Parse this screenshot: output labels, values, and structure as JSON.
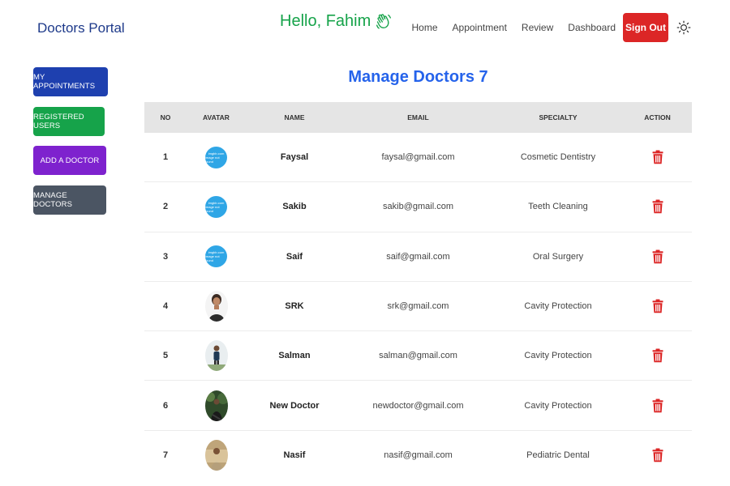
{
  "header": {
    "brand": "Doctors Portal",
    "greeting": "Hello, Fahim",
    "nav": [
      "Home",
      "Appointment",
      "Review",
      "Dashboard"
    ],
    "sign_out": "Sign Out"
  },
  "sidebar": {
    "items": [
      {
        "label": "MY APPOINTMENTS"
      },
      {
        "label": "REGISTERED USERS"
      },
      {
        "label": "ADD A DOCTOR"
      },
      {
        "label": "MANAGE DOCTORS"
      }
    ]
  },
  "main": {
    "title": "Manage Doctors 7",
    "columns": [
      "NO",
      "AVATAR",
      "NAME",
      "EMAIL",
      "SPECIALTY",
      "ACTION"
    ],
    "placeholder_avatar": {
      "line1": "imgbb.com",
      "line2": "image not found"
    },
    "rows": [
      {
        "no": "1",
        "name": "Faysal",
        "email": "faysal@gmail.com",
        "specialty": "Cosmetic Dentistry",
        "avatar": "placeholder"
      },
      {
        "no": "2",
        "name": "Sakib",
        "email": "sakib@gmail.com",
        "specialty": "Teeth Cleaning",
        "avatar": "placeholder"
      },
      {
        "no": "3",
        "name": "Saif",
        "email": "saif@gmail.com",
        "specialty": "Oral Surgery",
        "avatar": "placeholder"
      },
      {
        "no": "4",
        "name": "SRK",
        "email": "srk@gmail.com",
        "specialty": "Cavity Protection",
        "avatar": "photo"
      },
      {
        "no": "5",
        "name": "Salman",
        "email": "salman@gmail.com",
        "specialty": "Cavity Protection",
        "avatar": "photo"
      },
      {
        "no": "6",
        "name": "New Doctor",
        "email": "newdoctor@gmail.com",
        "specialty": "Cavity Protection",
        "avatar": "photo"
      },
      {
        "no": "7",
        "name": "Nasif",
        "email": "nasif@gmail.com",
        "specialty": "Pediatric Dental",
        "avatar": "photo"
      }
    ]
  },
  "colors": {
    "brand": "#1e3a8a",
    "greeting": "#16a34a",
    "sign_out": "#dc2626",
    "title": "#2563eb",
    "delete_icon": "#dc2626",
    "my_appointments": "#1e40af",
    "registered_users": "#16a34a",
    "add_doctor": "#7e22ce",
    "manage_doctors": "#4b5563"
  },
  "icons": {
    "greeting": "waving-hand-icon",
    "theme_toggle": "sun-icon",
    "delete": "trash-icon"
  }
}
